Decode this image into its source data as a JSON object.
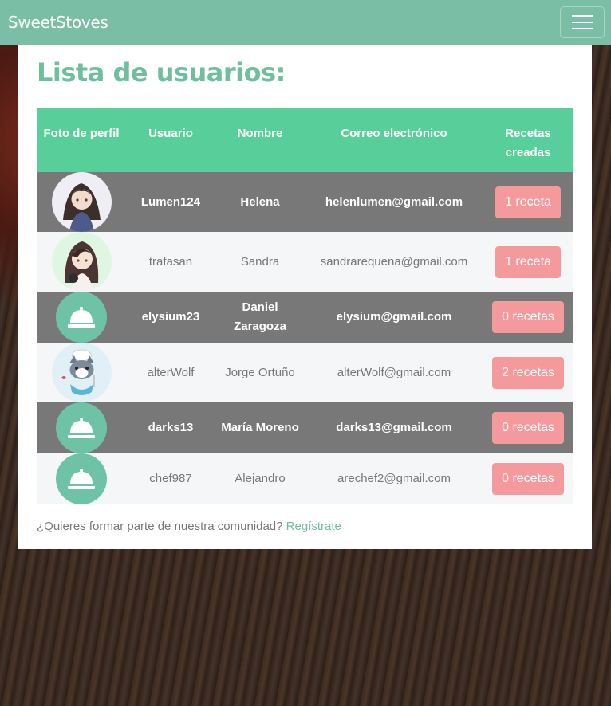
{
  "nav": {
    "brand": "SweetStoves",
    "menu_icon": "hamburger-icon"
  },
  "page": {
    "title": "Lista de usuarios:"
  },
  "table": {
    "headers": [
      "Foto de perfil",
      "Usuario",
      "Nombre",
      "Correo electrónico",
      "Recetas creadas"
    ],
    "rows": [
      {
        "avatar": "girl-avatar-image",
        "usuario": "Lumen124",
        "nombre": "Helena",
        "correo": "helenlumen@gmail.com",
        "recetas": "1 receta"
      },
      {
        "avatar": "girl-headphones-avatar-image",
        "usuario": "trafasan",
        "nombre": "Sandra",
        "correo": "sandrarequena@gmail.com",
        "recetas": "1 receta"
      },
      {
        "avatar": "service-bell-icon",
        "usuario": "elysium23",
        "nombre": "Daniel Zaragoza",
        "correo": "elysium@gmail.com",
        "recetas": "0 recetas"
      },
      {
        "avatar": "chef-wolf-avatar-image",
        "usuario": "alterWolf",
        "nombre": "Jorge Ortuño",
        "correo": "alterWolf@gmail.com",
        "recetas": "2 recetas"
      },
      {
        "avatar": "service-bell-icon",
        "usuario": "darks13",
        "nombre": "María Moreno",
        "correo": "darks13@gmail.com",
        "recetas": "0 recetas"
      },
      {
        "avatar": "service-bell-icon",
        "usuario": "chef987",
        "nombre": "Alejandro",
        "correo": "arechef2@gmail.com",
        "recetas": "0 recetas"
      }
    ]
  },
  "footer": {
    "text": "¿Quieres formar parte de nuestra comunidad?",
    "link": "Regístrate"
  },
  "colors": {
    "navbar": "#7abfa5",
    "header": "#58cf9a",
    "accent": "#6fbf9f",
    "badge": "#f49a9d",
    "dark_row": "#787878"
  }
}
